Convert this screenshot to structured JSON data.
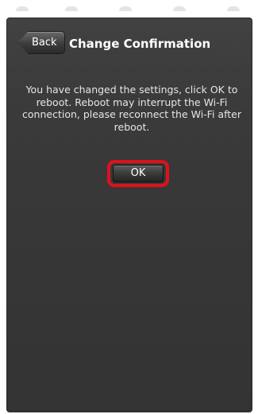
{
  "header": {
    "back_label": "Back",
    "title": "Change Confirmation"
  },
  "dialog": {
    "message": "You have changed the settings, click OK to reboot. Reboot may interrupt the Wi-Fi connection, please reconnect the Wi-Fi after reboot.",
    "ok_label": "OK"
  },
  "colors": {
    "panel_background": "#383838",
    "text": "#ffffff",
    "highlight": "#e0101c"
  },
  "icons": {
    "status_bar": "status-bar-indicator-icon"
  }
}
